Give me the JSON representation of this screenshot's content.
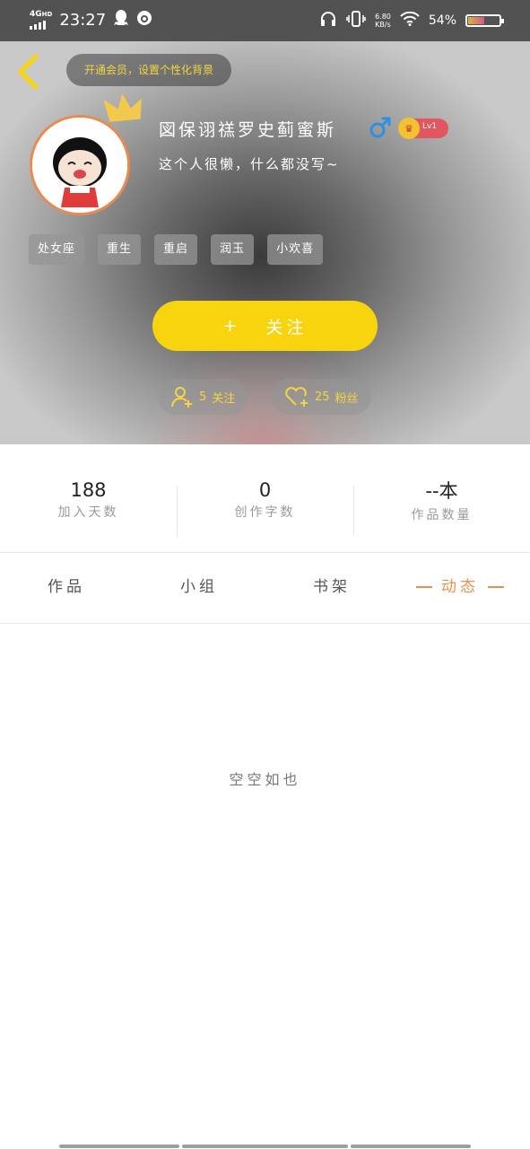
{
  "status_bar": {
    "network": "4G",
    "network_sup": "HD",
    "time": "23:27",
    "speed_value": "6.80",
    "speed_unit": "KB/s",
    "battery_percent": "54%",
    "battery_level": 0.54
  },
  "header": {
    "promo_text": "开通会员，设置个性化背景",
    "username": "図保诩禚罗史蓟蜜斯",
    "gender": "male",
    "level": "Lv1",
    "bio": "这个人很懒，什么都没写~",
    "tags": [
      "处女座",
      "重生",
      "重启",
      "润玉",
      "小欢喜"
    ],
    "follow_plus": "+",
    "follow_label": "关注",
    "following": {
      "count": "5",
      "label": "关注"
    },
    "fans": {
      "count": "25",
      "label": "粉丝"
    }
  },
  "stats": [
    {
      "value": "188",
      "label": "加入天数"
    },
    {
      "value": "0",
      "label": "创作字数"
    },
    {
      "value": "--本",
      "label": "作品数量"
    }
  ],
  "tabs": [
    {
      "label": "作品",
      "active": false
    },
    {
      "label": "小组",
      "active": false
    },
    {
      "label": "书架",
      "active": false
    },
    {
      "label": "动态",
      "active": true
    }
  ],
  "empty_text": "空空如也",
  "colors": {
    "accent_yellow": "#f8d40e",
    "accent_orange": "#e8914e",
    "gender_blue": "#2f8fe0",
    "level_red": "#e25660"
  }
}
